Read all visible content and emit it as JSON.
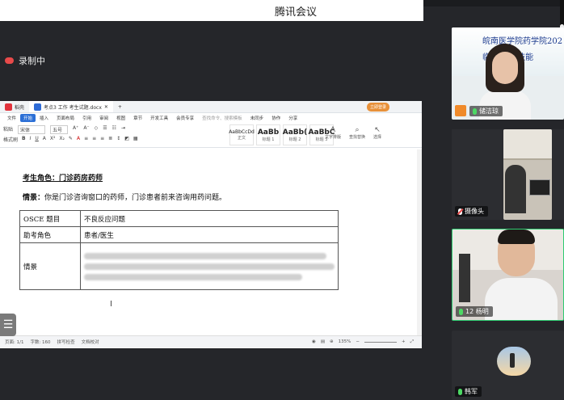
{
  "app": {
    "title": "腾讯会议",
    "recording_label": "录制中"
  },
  "wps": {
    "tabs": [
      {
        "label": "稻壳"
      },
      {
        "label": "考点3 工作 考生试题.docx"
      }
    ],
    "login_label": "立即登录",
    "menu": [
      "文件",
      "开始",
      "插入",
      "页面布局",
      "引用",
      "审阅",
      "视图",
      "章节",
      "开发工具",
      "会员专享"
    ],
    "search_placeholder": "查找命令、搜索模板",
    "font_name": "宋体",
    "font_size": "五号",
    "format_brush": "格式刷",
    "paste": "粘贴",
    "styles": [
      {
        "sample": "AaBbCcDd",
        "label": "正文"
      },
      {
        "sample": "AaBb",
        "label": "标题 1"
      },
      {
        "sample": "AaBb(",
        "label": "标题 2"
      },
      {
        "sample": "AaBbC",
        "label": "标题 3"
      }
    ],
    "tools": [
      {
        "icon": "A",
        "label": "文字排版"
      },
      {
        "icon": "⌕",
        "label": "查找替换"
      },
      {
        "icon": "↖",
        "label": "选择"
      }
    ],
    "share": [
      "未同步",
      "协作",
      "分享"
    ]
  },
  "document": {
    "role_heading": "考生角色：门诊药房药师",
    "scene_label": "情景：",
    "scene_text": "你是门诊咨询窗口的药师，门诊患者前来咨询用药问题。",
    "table": [
      {
        "label": "OSCE 题目",
        "value": "不良反应问题"
      },
      {
        "label": "助考角色",
        "value": "患者/医生"
      },
      {
        "label": "情景",
        "value": ""
      }
    ]
  },
  "status_bar": {
    "page": "页面: 1/1",
    "word_count": "字数: 160",
    "spell_check": "拼写检查",
    "doc_check": "文档校对",
    "zoom": "135%"
  },
  "participants": [
    {
      "name": "储洁琼",
      "mic": "on",
      "banner_l1": "皖南医学院药学院202",
      "banner_l2": "临     业毕业技能"
    },
    {
      "name": "摄像头",
      "mic": "off"
    },
    {
      "name": "12 杨明",
      "mic": "on"
    },
    {
      "name": "韩军",
      "mic": "on"
    }
  ],
  "colors": {
    "accent": "#2b6fd6",
    "speaking_border": "#2ecc71",
    "recording": "#e84a4a"
  }
}
